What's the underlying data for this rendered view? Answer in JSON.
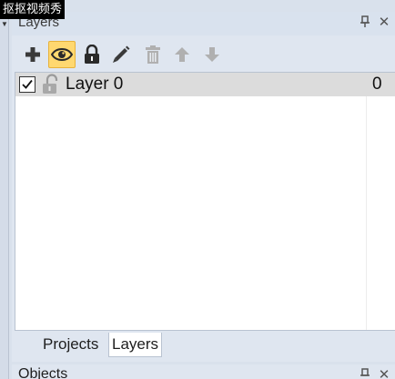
{
  "watermark": {
    "text": "抠抠视频秀"
  },
  "panel": {
    "title": "Layers",
    "pin_icon": "pin-icon",
    "close_icon": "close-icon",
    "close_glyph": "✕"
  },
  "toolbar": {
    "buttons": [
      {
        "icon": "add-icon",
        "active": false
      },
      {
        "icon": "eye-icon",
        "active": true
      },
      {
        "icon": "lock-icon",
        "active": false
      },
      {
        "icon": "pencil-icon",
        "active": false
      },
      {
        "icon": "trash-icon",
        "active": false,
        "disabled": true
      },
      {
        "icon": "arrow-up-icon",
        "active": false,
        "disabled": true
      },
      {
        "icon": "arrow-down-icon",
        "active": false,
        "disabled": true
      }
    ],
    "active_color": "#ffd870"
  },
  "layers": [
    {
      "name": "Layer 0",
      "count": "0",
      "visible": true,
      "locked": false
    }
  ],
  "tabs": [
    {
      "label": "Projects",
      "active": false
    },
    {
      "label": "Layers",
      "active": true
    }
  ],
  "panel2": {
    "title": "Objects"
  }
}
